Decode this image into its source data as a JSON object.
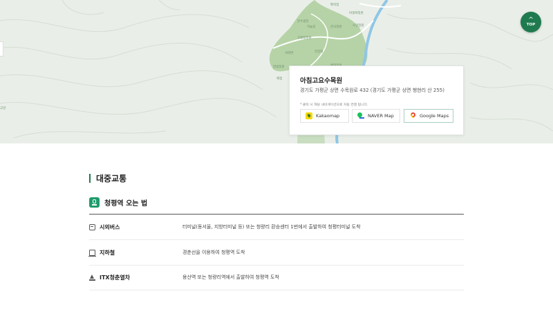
{
  "map": {
    "labels": [
      "편의점",
      "분수광장",
      "하늘길",
      "고향집정원",
      "한국정원",
      "소망정원",
      "전망대",
      "서화연",
      "에덴정원",
      "달빛정원",
      "매점",
      "야생화정원",
      "고양"
    ],
    "top_button_label": "TOP"
  },
  "place_card": {
    "title": "아침고요수목원",
    "address": "경기도 가평군 상면 수목원로 432 (경기도 가평군 상면 행현리 산 255)",
    "note": "* 클릭 시 해당 내비게이션으로 자동 연결 됩니다.",
    "buttons": [
      {
        "label": "Kakaomap",
        "icon": "kakaomap-icon"
      },
      {
        "label": "NAVER Map",
        "icon": "naver-map-icon"
      },
      {
        "label": "Google Maps",
        "icon": "google-maps-icon"
      }
    ]
  },
  "transit": {
    "section_title": "대중교통",
    "subsection_title": "청평역 오는 법",
    "rows": [
      {
        "label": "시외버스",
        "desc": "터미널(동서울, 지방터미널 등) 또는 청량리 환승센터 1번에서 출발하여 청평터미널 도착",
        "icon": "bus-icon"
      },
      {
        "label": "지하철",
        "desc": "경춘선을 이용하여 청평역 도착",
        "icon": "subway-icon"
      },
      {
        "label": "ITX청춘열차",
        "desc": "용산역 또는 청량리역에서 출발하여 청평역 도착",
        "icon": "train-icon"
      }
    ]
  },
  "colors": {
    "accent": "#1f7a4f",
    "map_bg": "#e9efe8",
    "garden": "#b6d3a7",
    "river": "#8fc6e6"
  }
}
